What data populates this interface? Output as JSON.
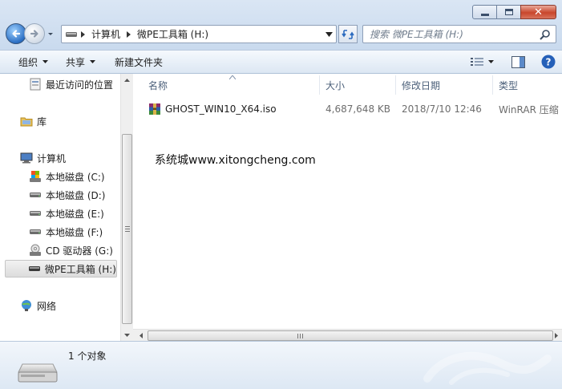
{
  "window": {
    "controls": {
      "minimize": "minimize",
      "maximize": "maximize",
      "close": "close"
    }
  },
  "address_bar": {
    "breadcrumbs": [
      "计算机",
      "微PE工具箱 (H:)"
    ]
  },
  "search": {
    "placeholder": "搜索 微PE工具箱 (H:)"
  },
  "toolbar": {
    "organize": "组织",
    "share": "共享",
    "new_folder": "新建文件夹"
  },
  "nav_pane": {
    "items": [
      {
        "label": "最近访问的位置",
        "icon": "recent-places-icon"
      },
      {
        "label": "库",
        "icon": "library-icon"
      },
      {
        "label": "计算机",
        "icon": "computer-icon"
      },
      {
        "label": "本地磁盘 (C:)",
        "icon": "system-drive-icon"
      },
      {
        "label": "本地磁盘 (D:)",
        "icon": "drive-icon"
      },
      {
        "label": "本地磁盘 (E:)",
        "icon": "drive-icon"
      },
      {
        "label": "本地磁盘 (F:)",
        "icon": "drive-icon"
      },
      {
        "label": "CD 驱动器 (G:)",
        "icon": "cd-drive-icon"
      },
      {
        "label": "微PE工具箱 (H:)",
        "icon": "drive-icon",
        "selected": true
      },
      {
        "label": "网络",
        "icon": "network-icon"
      }
    ]
  },
  "file_list": {
    "columns": [
      "名称",
      "大小",
      "修改日期",
      "类型"
    ],
    "rows": [
      {
        "name": "GHOST_WIN10_X64.iso",
        "size": "4,687,648 KB",
        "modified": "2018/7/10 12:46",
        "type": "WinRAR 压缩",
        "icon": "winrar-archive-icon"
      }
    ]
  },
  "watermark_text": "系统城www.xitongcheng.com",
  "details_pane": {
    "count": "1 个对象"
  }
}
